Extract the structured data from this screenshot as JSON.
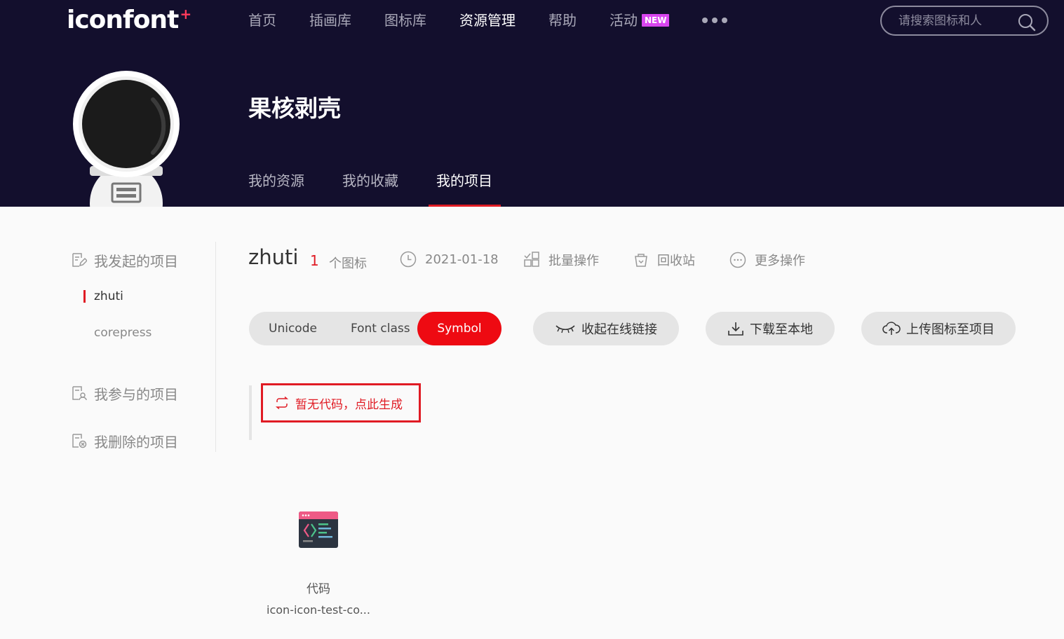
{
  "header": {
    "logo": "iconfont",
    "logo_plus": "+",
    "nav": [
      {
        "label": "首页",
        "active": false
      },
      {
        "label": "插画库",
        "active": false
      },
      {
        "label": "图标库",
        "active": false
      },
      {
        "label": "资源管理",
        "active": true
      },
      {
        "label": "帮助",
        "active": false
      },
      {
        "label": "活动",
        "active": false,
        "badge": "NEW"
      }
    ],
    "search_placeholder": "请搜索图标和人"
  },
  "profile": {
    "name": "果核剥壳",
    "tabs": [
      {
        "label": "我的资源",
        "active": false
      },
      {
        "label": "我的收藏",
        "active": false
      },
      {
        "label": "我的项目",
        "active": true
      }
    ]
  },
  "sidebar": {
    "created_label": "我发起的项目",
    "projects": [
      {
        "label": "zhuti",
        "active": true
      },
      {
        "label": "corepress",
        "active": false
      }
    ],
    "joined_label": "我参与的项目",
    "deleted_label": "我删除的项目"
  },
  "project": {
    "title": "zhuti",
    "icon_count": "1",
    "icon_count_label": "个图标",
    "date": "2021-01-18",
    "batch_label": "批量操作",
    "recycle_label": "回收站",
    "more_label": "更多操作"
  },
  "toolbar": {
    "formats": [
      "Unicode",
      "Font class",
      "Symbol"
    ],
    "active_format": "Symbol",
    "collapse_label": "收起在线链接",
    "download_label": "下载至本地",
    "upload_label": "上传图标至项目"
  },
  "code": {
    "generate_label": "暂无代码，点此生成"
  },
  "icons": [
    {
      "name": "代码",
      "code": "icon-icon-test-co..."
    }
  ],
  "colors": {
    "header_bg": "#130f2d",
    "accent": "#e01b24",
    "badge": "#d946ef"
  }
}
